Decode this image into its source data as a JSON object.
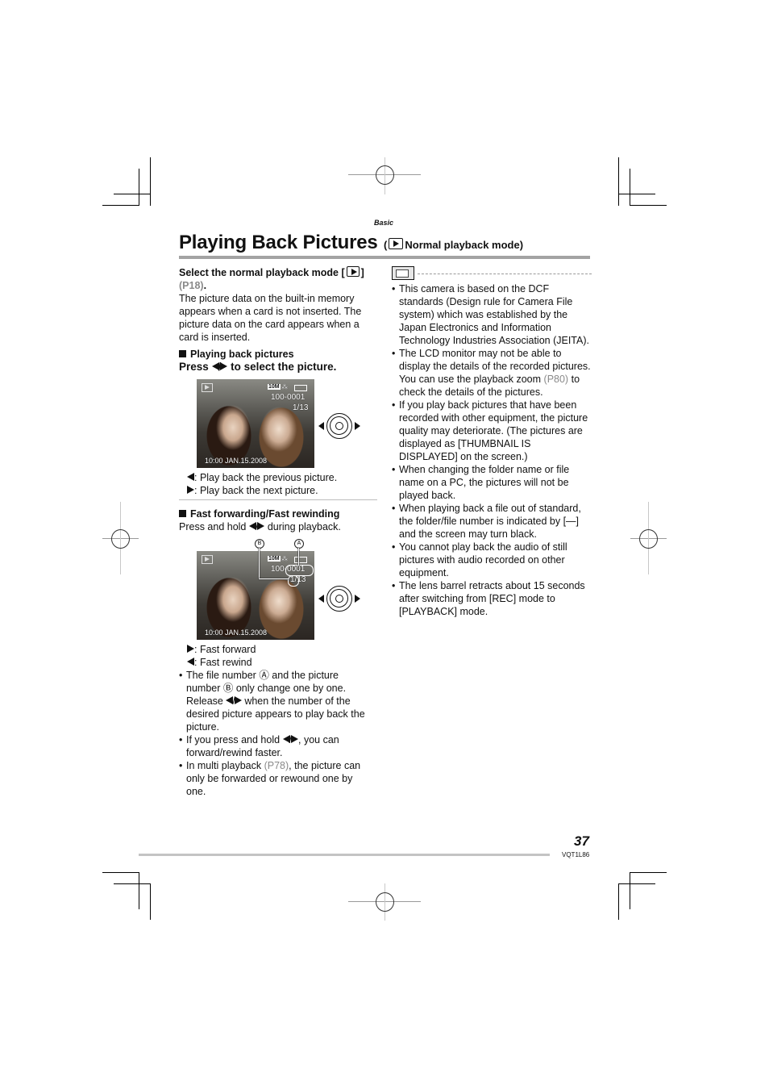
{
  "page": {
    "section_label": "Basic",
    "title": "Playing Back Pictures",
    "title_mode_open": "(",
    "title_mode_label": "Normal playback mode)",
    "page_number": "37",
    "model_code": "VQT1L86"
  },
  "left_column": {
    "intro_heading_prefix": "Select the normal playback mode [",
    "intro_heading_suffix": "]",
    "intro_ref": "(P18)",
    "intro_ref_tail": ".",
    "intro_body": "The picture data on the built-in memory appears when a card is not inserted. The picture data on the card appears when a card is inserted.",
    "playing_back": {
      "heading": "Playing back pictures",
      "instruction_prefix": "Press",
      "instruction_suffix": "to select the picture.",
      "screen": {
        "resolution_badge": "10M",
        "file_number": "100-0001",
        "picture_number": "1/13",
        "datetime": "10:00  JAN.15.2008"
      },
      "legend": [
        {
          "key": "left",
          "text": ": Play back the previous picture."
        },
        {
          "key": "right",
          "text": ": Play back the next picture."
        }
      ]
    },
    "fast": {
      "heading": "Fast forwarding/Fast rewinding",
      "instruction_prefix": "Press and hold",
      "instruction_suffix": "during playback.",
      "callout_a": "A",
      "callout_b": "B",
      "screen": {
        "resolution_badge": "10M",
        "file_number": "100-0001",
        "picture_number": "1/13",
        "datetime": "10:00  JAN.15.2008"
      },
      "legend": [
        {
          "key": "right",
          "text": ": Fast forward"
        },
        {
          "key": "left",
          "text": ": Fast rewind"
        }
      ],
      "bullets": {
        "b1_part1": "The file number Ⓐ and the picture number Ⓑ only change one by one. Release",
        "b1_part2": "when the number of the desired picture appears to play back the picture.",
        "b2_part1": "If you press and hold",
        "b2_part2": ", you can forward/rewind faster.",
        "b3_part1": "In multi playback",
        "b3_ref": "(P78)",
        "b3_part2": ", the picture can only be forwarded or rewound one by one."
      }
    }
  },
  "right_column": {
    "notes": [
      {
        "text": "This camera is based on the DCF standards (Design rule for Camera File system) which was established by the Japan Electronics and Information Technology Industries Association (JEITA)."
      },
      {
        "text_before": "The LCD monitor may not be able to display the details of the recorded pictures. You can use the playback zoom",
        "ref": "(P80)",
        "text_after": "to check the details of the pictures."
      },
      {
        "text": "If you play back pictures that have been recorded with other equipment, the picture quality may deteriorate. (The pictures are displayed as [THUMBNAIL IS DISPLAYED] on the screen.)"
      },
      {
        "text": "When changing the folder name or file name on a PC, the pictures will not be played back."
      },
      {
        "text": "When playing back a file out of standard, the folder/file number is indicated by [—] and the screen may turn black."
      },
      {
        "text": "You cannot play back the audio of still pictures with audio recorded on other equipment."
      },
      {
        "text": "The lens barrel retracts about 15 seconds after switching from [REC] mode to [PLAYBACK] mode."
      }
    ]
  },
  "colors": {
    "text": "#111111",
    "reference_link": "#8a8a8a",
    "rule": "#a3a3a3"
  }
}
